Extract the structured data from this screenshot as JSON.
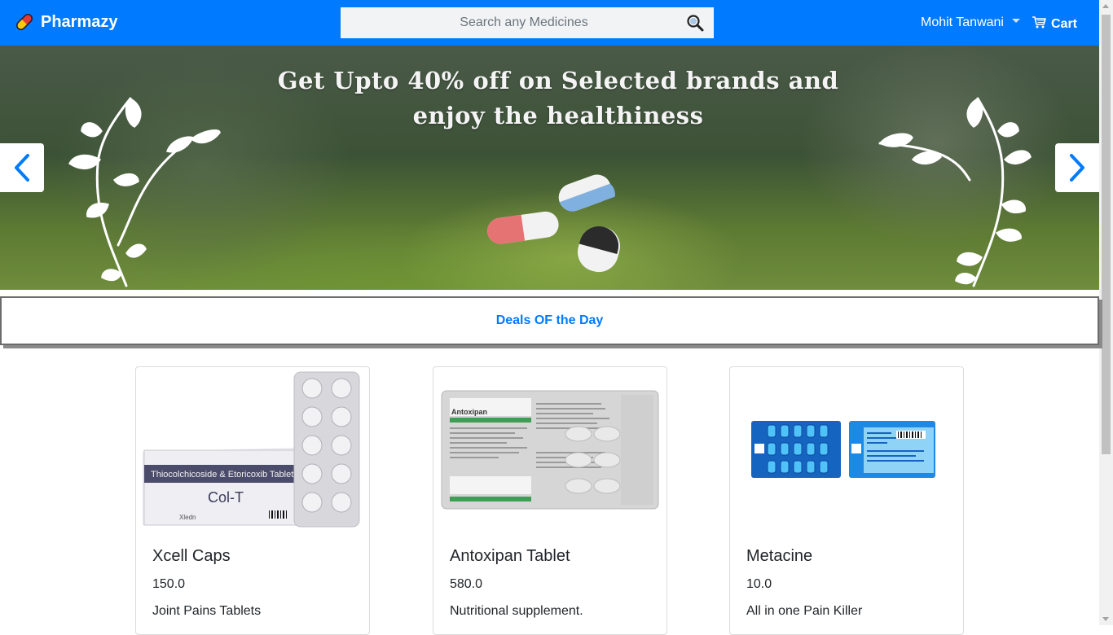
{
  "brand": {
    "name": "Pharmazy",
    "logo_icon": "capsule-icon"
  },
  "search": {
    "placeholder": "Search any Medicines",
    "value": "",
    "icon": "search-icon"
  },
  "user": {
    "name": "Mohit Tanwani"
  },
  "cart": {
    "label": "Cart",
    "icon": "cart-icon"
  },
  "banner": {
    "headline": "Get Upto 40% off on Selected brands and enjoy the healthiness"
  },
  "deals": {
    "label": "Deals OF the Day"
  },
  "products": [
    {
      "name": "Xcell Caps",
      "price": "150.0",
      "description": "Joint Pains Tablets",
      "box_brand": "Thiocolchicoside & Etoricoxib Tablets",
      "box_name": "Col-T",
      "box_maker": "Xledn"
    },
    {
      "name": "Antoxipan Tablet",
      "price": "580.0",
      "description": "Nutritional supplement.",
      "strip_name": "Antoxipan"
    },
    {
      "name": "Metacine",
      "price": "10.0",
      "description": "All in one Pain Killer"
    }
  ],
  "colors": {
    "primary": "#007bff",
    "navbar_text": "#ffffff"
  }
}
